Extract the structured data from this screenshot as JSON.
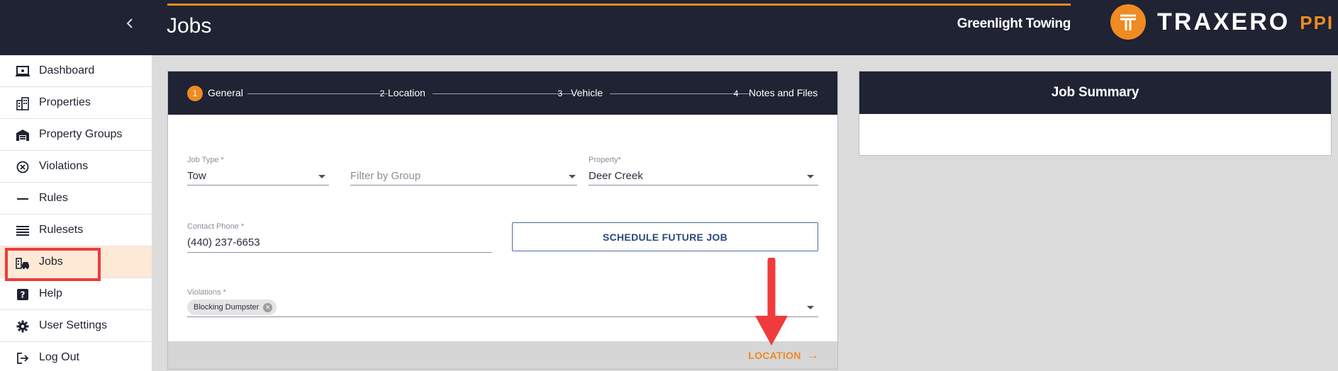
{
  "header": {
    "title": "Jobs",
    "company": "Greenlight Towing",
    "logo_word": "TRAXERO",
    "logo_suffix": "PPI",
    "accent_color": "#f08a22"
  },
  "sidebar": {
    "items": [
      {
        "label": "Dashboard",
        "icon": "dashboard-icon"
      },
      {
        "label": "Properties",
        "icon": "buildings-icon"
      },
      {
        "label": "Property Groups",
        "icon": "warehouse-icon"
      },
      {
        "label": "Violations",
        "icon": "circle-x-icon"
      },
      {
        "label": "Rules",
        "icon": "dash-icon"
      },
      {
        "label": "Rulesets",
        "icon": "list-icon"
      },
      {
        "label": "Jobs",
        "icon": "jobs-icon",
        "active": true
      },
      {
        "label": "Help",
        "icon": "help-icon"
      },
      {
        "label": "User Settings",
        "icon": "gear-icon"
      },
      {
        "label": "Log Out",
        "icon": "logout-icon"
      }
    ]
  },
  "stepper": {
    "steps": [
      {
        "num": "1",
        "label": "General",
        "active": true
      },
      {
        "num": "2",
        "label": "Location"
      },
      {
        "num": "3",
        "label": "Vehicle"
      },
      {
        "num": "4",
        "label": "Notes and Files"
      }
    ]
  },
  "form": {
    "job_type": {
      "label": "Job Type *",
      "value": "Tow"
    },
    "group_filter": {
      "placeholder": "Filter by Group"
    },
    "property": {
      "label": "Property*",
      "value": "Deer Creek"
    },
    "contact_phone": {
      "label": "Contact Phone *",
      "value": "(440) 237-6653"
    },
    "schedule_button": "SCHEDULE FUTURE JOB",
    "violations": {
      "label": "Violations *",
      "chips": [
        "Blocking Dumpster"
      ]
    },
    "next_button": "LOCATION"
  },
  "summary": {
    "title": "Job Summary"
  }
}
